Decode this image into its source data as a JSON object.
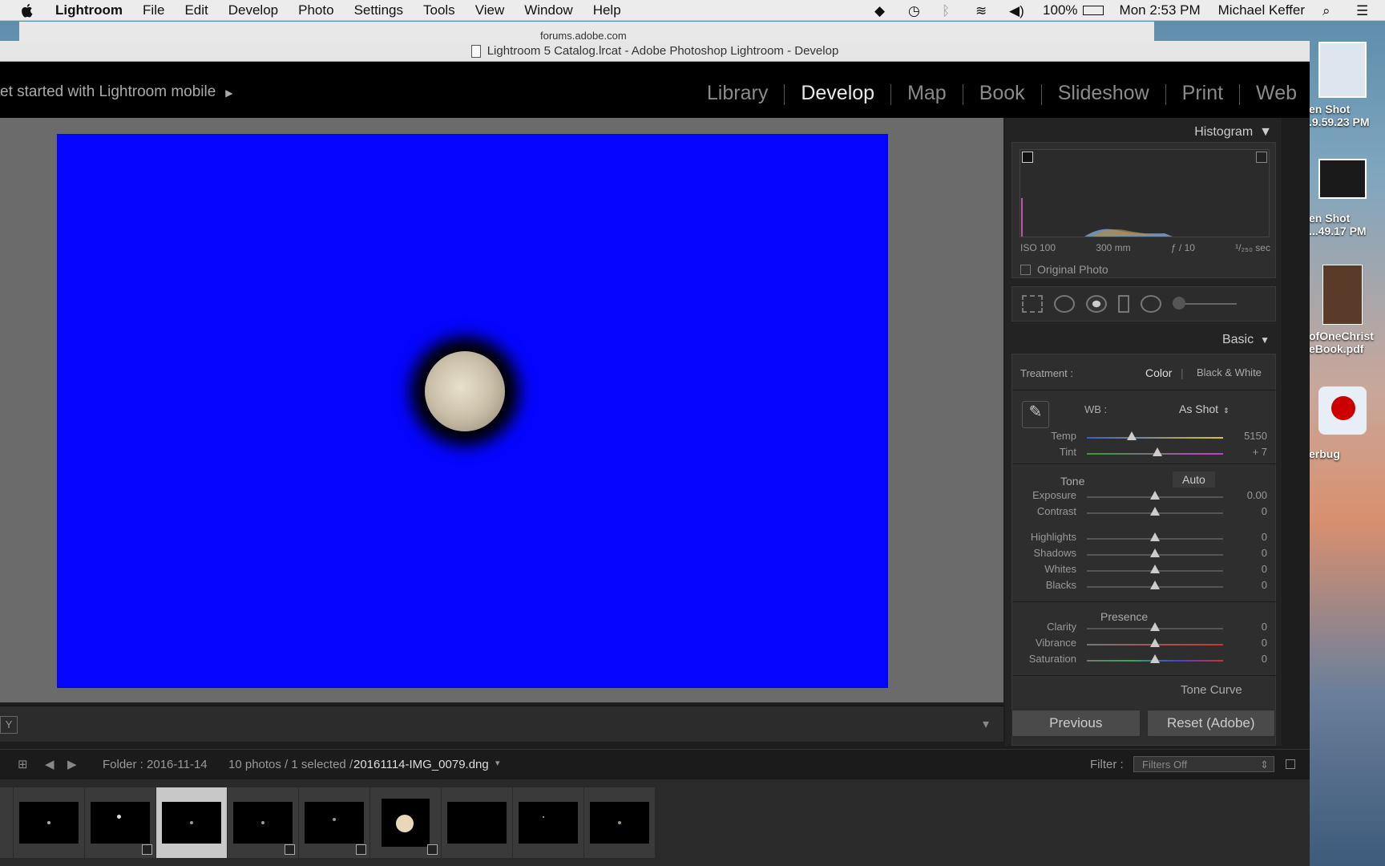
{
  "menubar": {
    "app_name": "Lightroom",
    "menus": [
      "File",
      "Edit",
      "Develop",
      "Photo",
      "Settings",
      "Tools",
      "View",
      "Window",
      "Help"
    ],
    "battery": "100%",
    "clock": "Mon 2:53 PM",
    "user": "Michael Keffer"
  },
  "browser": {
    "url": "forums.adobe.com"
  },
  "desktop_icons": [
    {
      "label": "en Shot\n.9.59.23 PM"
    },
    {
      "label": "en Shot\n...49.17 PM"
    },
    {
      "label": "ofOneChrist\neBook.pdf"
    },
    {
      "label": "erbug"
    }
  ],
  "window": {
    "title": "Lightroom 5 Catalog.lrcat - Adobe Photoshop Lightroom - Develop"
  },
  "topnav": {
    "mobile_text": "et started with Lightroom mobile",
    "modules": [
      "Library",
      "Develop",
      "Map",
      "Book",
      "Slideshow",
      "Print",
      "Web"
    ],
    "active_module": "Develop"
  },
  "histogram": {
    "title": "Histogram",
    "iso": "ISO 100",
    "focal": "300 mm",
    "aperture": "ƒ / 10",
    "shutter": "¹/₂₅₀ sec",
    "original_photo": "Original Photo"
  },
  "basic": {
    "title": "Basic",
    "treatment_label": "Treatment :",
    "treatment_color": "Color",
    "treatment_bw": "Black & White",
    "wb_label": "WB :",
    "wb_value": "As Shot",
    "tone_label": "Tone",
    "auto_label": "Auto",
    "presence_label": "Presence",
    "sliders": [
      {
        "name": "Temp",
        "value": "5150",
        "pos": 0.33
      },
      {
        "name": "Tint",
        "value": "+ 7",
        "pos": 0.52
      },
      {
        "name": "Exposure",
        "value": "0.00",
        "pos": 0.5
      },
      {
        "name": "Contrast",
        "value": "0",
        "pos": 0.5
      },
      {
        "name": "Highlights",
        "value": "0",
        "pos": 0.5
      },
      {
        "name": "Shadows",
        "value": "0",
        "pos": 0.5
      },
      {
        "name": "Whites",
        "value": "0",
        "pos": 0.5
      },
      {
        "name": "Blacks",
        "value": "0",
        "pos": 0.5
      },
      {
        "name": "Clarity",
        "value": "0",
        "pos": 0.5
      },
      {
        "name": "Vibrance",
        "value": "0",
        "pos": 0.5
      },
      {
        "name": "Saturation",
        "value": "0",
        "pos": 0.5
      }
    ],
    "next_panel": "Tone Curve"
  },
  "buttons": {
    "previous": "Previous",
    "reset": "Reset (Adobe)"
  },
  "filmbar": {
    "folder": "Folder : 2016-11-14",
    "count": "10 photos / 1 selected /",
    "filename": "20161114-IMG_0079.dng",
    "filter_label": "Filter :",
    "filter_value": "Filters Off"
  },
  "colors": {
    "photo_bg": "#0505ff",
    "active_module": "#e8e8e8"
  }
}
